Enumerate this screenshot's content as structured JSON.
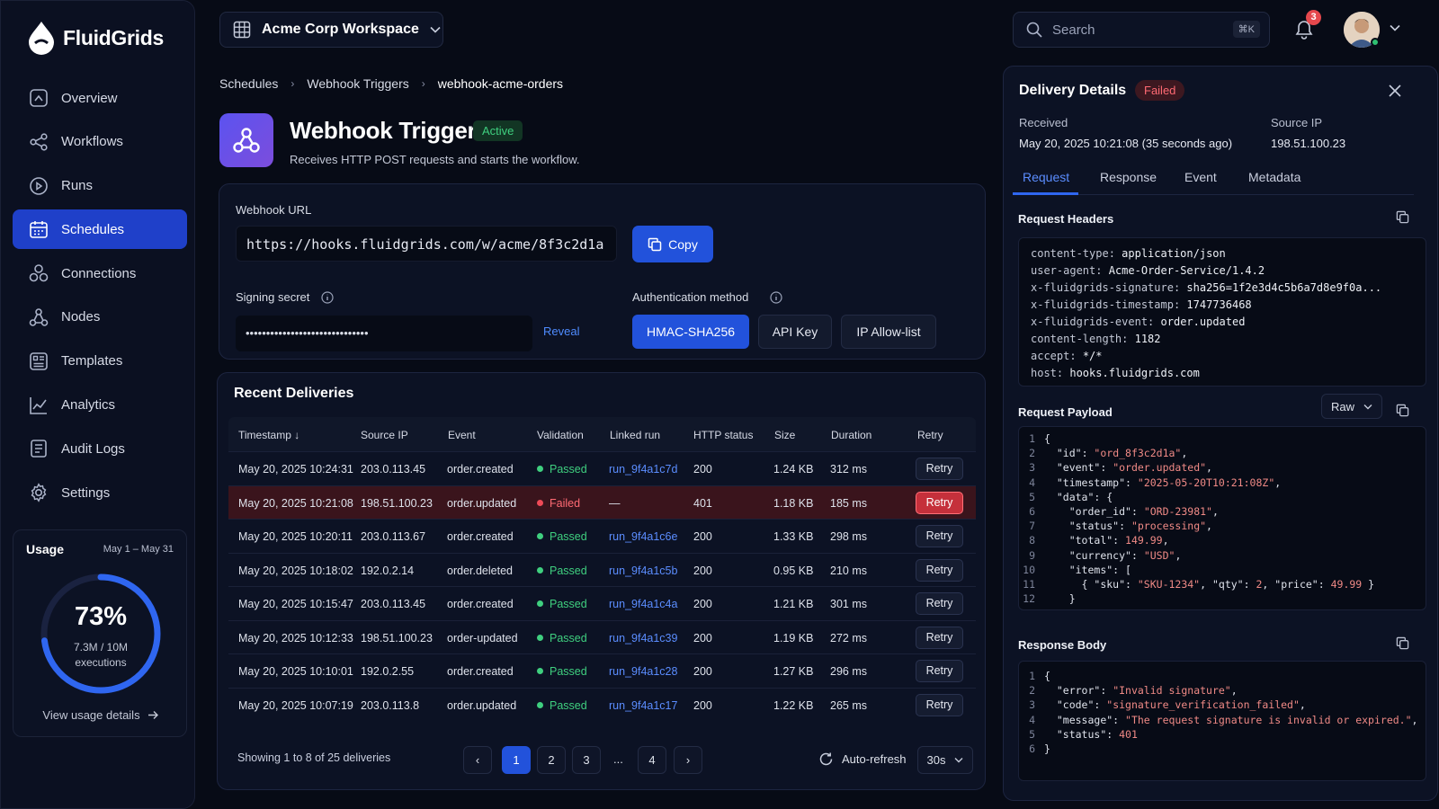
{
  "app": {
    "name": "FluidGrids"
  },
  "nav": [
    {
      "label": "Overview",
      "icon": "overview-icon"
    },
    {
      "label": "Workflows",
      "icon": "workflows-icon"
    },
    {
      "label": "Runs",
      "icon": "runs-icon"
    },
    {
      "label": "Schedules",
      "icon": "calendar-icon",
      "active": true
    },
    {
      "label": "Connections",
      "icon": "connections-icon"
    },
    {
      "label": "Nodes",
      "icon": "nodes-icon"
    },
    {
      "label": "Templates",
      "icon": "templates-icon"
    },
    {
      "label": "Analytics",
      "icon": "analytics-icon"
    },
    {
      "label": "Audit Logs",
      "icon": "audit-logs-icon"
    },
    {
      "label": "Settings",
      "icon": "gear-icon"
    }
  ],
  "usage": {
    "title": "Usage",
    "range": "May 1 – May 31",
    "percent": "73%",
    "percent_value": 73,
    "detail_line1": "7.3M / 10M",
    "detail_line2": "executions",
    "link": "View usage details"
  },
  "topbar": {
    "workspace": "Acme Corp Workspace",
    "search_placeholder": "Search",
    "search_shortcut": "⌘K",
    "notifications": "3"
  },
  "breadcrumb": [
    "Schedules",
    "Webhook Triggers",
    "webhook-acme-orders"
  ],
  "trigger": {
    "title": "Webhook Trigger",
    "status": "Active",
    "description": "Receives HTTP POST requests and starts the workflow."
  },
  "webhook": {
    "url_label": "Webhook URL",
    "url": "https://hooks.fluidgrids.com/w/acme/8f3c2d1a",
    "copy_label": "Copy",
    "secret_label": "Signing secret",
    "secret_mask": "••••••••••••••••••••••••••••••",
    "reveal_label": "Reveal",
    "auth_label": "Authentication method",
    "auth_options": [
      "HMAC-SHA256",
      "API Key",
      "IP Allow-list"
    ]
  },
  "deliveries": {
    "title": "Recent Deliveries",
    "columns": [
      "Timestamp",
      "Source IP",
      "Event",
      "Validation",
      "Linked run",
      "HTTP status",
      "Size",
      "Duration",
      "Retry"
    ],
    "rows": [
      {
        "ts": "May 20, 2025 10:24:31",
        "ip": "203.0.113.45",
        "event": "order.created",
        "validation": "Passed",
        "run": "run_9f4a1c7d",
        "status": "200",
        "size": "1.24 KB",
        "duration": "312 ms",
        "retry": "Retry"
      },
      {
        "ts": "May 20, 2025 10:21:08",
        "ip": "198.51.100.23",
        "event": "order.updated",
        "validation": "Failed",
        "run": "—",
        "status": "401",
        "size": "1.18 KB",
        "duration": "185 ms",
        "retry": "Retry",
        "failed": true
      },
      {
        "ts": "May 20, 2025 10:20:11",
        "ip": "203.0.113.67",
        "event": "order.created",
        "validation": "Passed",
        "run": "run_9f4a1c6e",
        "status": "200",
        "size": "1.33 KB",
        "duration": "298 ms",
        "retry": "Retry"
      },
      {
        "ts": "May 20, 2025 10:18:02",
        "ip": "192.0.2.14",
        "event": "order.deleted",
        "validation": "Passed",
        "run": "run_9f4a1c5b",
        "status": "200",
        "size": "0.95 KB",
        "duration": "210 ms",
        "retry": "Retry"
      },
      {
        "ts": "May 20, 2025 10:15:47",
        "ip": "203.0.113.45",
        "event": "order.created",
        "validation": "Passed",
        "run": "run_9f4a1c4a",
        "status": "200",
        "size": "1.21 KB",
        "duration": "301 ms",
        "retry": "Retry"
      },
      {
        "ts": "May 20, 2025 10:12:33",
        "ip": "198.51.100.23",
        "event": "order-updated",
        "validation": "Passed",
        "run": "run_9f4a1c39",
        "status": "200",
        "size": "1.19 KB",
        "duration": "272 ms",
        "retry": "Retry"
      },
      {
        "ts": "May 20, 2025 10:10:01",
        "ip": "192.0.2.55",
        "event": "order.created",
        "validation": "Passed",
        "run": "run_9f4a1c28",
        "status": "200",
        "size": "1.27 KB",
        "duration": "296 ms",
        "retry": "Retry"
      },
      {
        "ts": "May 20, 2025 10:07:19",
        "ip": "203.0.113.8",
        "event": "order.updated",
        "validation": "Passed",
        "run": "run_9f4a1c17",
        "status": "200",
        "size": "1.22 KB",
        "duration": "265 ms",
        "retry": "Retry"
      }
    ],
    "showing": "Showing 1 to 8 of 25 deliveries",
    "pages": [
      "1",
      "2",
      "3",
      "4"
    ],
    "ellipsis": "...",
    "auto_refresh": "Auto-refresh",
    "refresh_interval": "30s"
  },
  "panel": {
    "title": "Delivery Details",
    "status": "Failed",
    "received_label": "Received",
    "received_value": "May 20, 2025 10:21:08 (35 seconds ago)",
    "ip_label": "Source IP",
    "ip_value": "198.51.100.23",
    "tabs": [
      "Request",
      "Response",
      "Event",
      "Metadata"
    ],
    "headers_title": "Request Headers",
    "headers": [
      {
        "k": "content-type:",
        "v": "application/json"
      },
      {
        "k": "user-agent:",
        "v": "Acme-Order-Service/1.4.2"
      },
      {
        "k": "x-fluidgrids-signature:",
        "v": "sha256=1f2e3d4c5b6a7d8e9f0a..."
      },
      {
        "k": "x-fluidgrids-timestamp:",
        "v": "1747736468"
      },
      {
        "k": "x-fluidgrids-event:",
        "v": "order.updated"
      },
      {
        "k": "content-length:",
        "v": "1182"
      },
      {
        "k": "accept:",
        "v": "*/*"
      },
      {
        "k": "host:",
        "v": "hooks.fluidgrids.com"
      }
    ],
    "payload_title": "Request Payload",
    "payload_format": "Raw",
    "payload_lines": [
      "{",
      "  \"id\": \"ord_8f3c2d1a\",",
      "  \"event\": \"order.updated\",",
      "  \"timestamp\": \"2025-05-20T10:21:08Z\",",
      "  \"data\": {",
      "    \"order_id\": \"ORD-23981\",",
      "    \"status\": \"processing\",",
      "    \"total\": 149.99,",
      "    \"currency\": \"USD\",",
      "    \"items\": [",
      "      { \"sku\": \"SKU-1234\", \"qty\": 2, \"price\": 49.99 }",
      "    }"
    ],
    "response_title": "Response Body",
    "response_lines": [
      "{",
      "  \"error\": \"Invalid signature\",",
      "  \"code\": \"signature_verification_failed\",",
      "  \"message\": \"The request signature is invalid or expired.\",",
      "  \"status\": 401",
      "}"
    ]
  },
  "colors": {
    "accent": "#2252db",
    "success": "#3fcf7f",
    "danger": "#ef4a57",
    "background": "#070b16"
  }
}
